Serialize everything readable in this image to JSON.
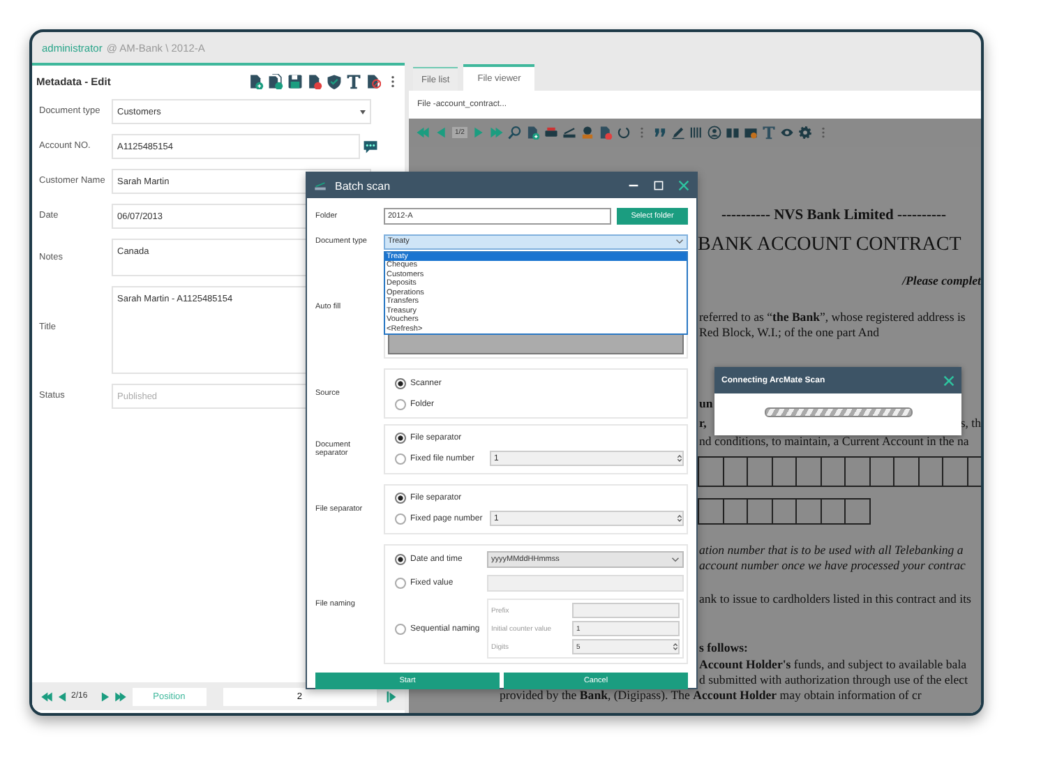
{
  "header": {
    "user": "administrator",
    "context": "@ AM-Bank \\ 2012-A"
  },
  "metadata": {
    "title": "Metadata - Edit",
    "fields": [
      {
        "label": "Document type",
        "kind": "select",
        "value": "Customers"
      },
      {
        "label": "Account NO.",
        "kind": "annotated",
        "value": "A1125485154"
      },
      {
        "label": "Customer Name",
        "kind": "text",
        "value": "Sarah Martin"
      },
      {
        "label": "Date",
        "kind": "text",
        "value": "06/07/2013"
      },
      {
        "label": "Notes",
        "kind": "memo",
        "value": "Canada"
      },
      {
        "label": "Title",
        "kind": "textarea",
        "value": "Sarah Martin - A1125485154"
      },
      {
        "label": "Status",
        "kind": "text",
        "placeholder": "Published"
      }
    ]
  },
  "footer": {
    "page": "2/16",
    "position_button": "Position",
    "position_value": "2"
  },
  "viewer": {
    "tabs": [
      {
        "label": "File list",
        "selected": false
      },
      {
        "label": "File viewer",
        "selected": true
      }
    ],
    "file_name": "File -account_contract...",
    "page": "1/2",
    "lines": [
      {
        "kind": "banner",
        "text": "---------- NVS Bank Limited ----------"
      },
      {
        "kind": "title",
        "text": "BANK ACCOUNT CONTRACT"
      },
      {
        "kind": "note",
        "text": "/Please complet"
      },
      {
        "kind": "body",
        "clipped": true,
        "text": "referred to as “**the Bank**”, whose registered address is"
      },
      {
        "kind": "body",
        "clipped": true,
        "text": "Red Block, W.I.; of the one part And"
      },
      {
        "kind": "section",
        "clipped": true,
        "text": "un"
      },
      {
        "kind": "split",
        "clipped": true,
        "text": "**r,**",
        "right": "s, th"
      },
      {
        "kind": "body",
        "clipped": true,
        "text": "nd conditions, to maintain, a Current Account in the na"
      },
      {
        "kind": "boxrow"
      },
      {
        "kind": "boxrowshort"
      },
      {
        "kind": "italic",
        "clipped": true,
        "text": "ation number that is to be used with all Telebanking a"
      },
      {
        "kind": "italic",
        "clipped": true,
        "text": "account number once we have processed your contrac"
      },
      {
        "kind": "body",
        "clipped": true,
        "text": "ank to issue to cardholders listed in this contract and its"
      },
      {
        "kind": "heading",
        "clipped": true,
        "text": "s follows:"
      },
      {
        "kind": "body",
        "clipped": true,
        "text": "**Account Holder's** funds, and subject to available bala"
      },
      {
        "kind": "body",
        "clipped": true,
        "text": "d submitted with authorization through use of the elect"
      },
      {
        "kind": "body",
        "clipped": false,
        "text": "provided by the **Bank**, (Digipass). The **Account Holder** may obtain information of cr"
      }
    ]
  },
  "batch_scan": {
    "title": "Batch scan",
    "folder": {
      "label": "Folder",
      "value": "2012-A",
      "button": "Select folder"
    },
    "document_type": {
      "label": "Document type",
      "value": "Treaty",
      "expanded": true,
      "options": [
        {
          "label": "Treaty",
          "selected": true
        },
        {
          "label": "Cheques",
          "selected": false
        },
        {
          "label": "Customers",
          "selected": false
        },
        {
          "label": "Deposits",
          "selected": false
        },
        {
          "label": "Operations",
          "selected": false
        },
        {
          "label": "Transfers",
          "selected": false
        },
        {
          "label": "Treasury",
          "selected": false
        },
        {
          "label": "Vouchers",
          "selected": false
        },
        {
          "label": "<Refresh>",
          "selected": false
        }
      ]
    },
    "auto_fill": {
      "label": "Auto fill"
    },
    "source": {
      "label": "Source",
      "options": [
        {
          "label": "Scanner",
          "selected": true
        },
        {
          "label": "Folder",
          "selected": false
        }
      ]
    },
    "document_separator": {
      "label": "Document separator",
      "options": [
        {
          "label": "File separator",
          "selected": true
        },
        {
          "label": "Fixed file number",
          "selected": false,
          "value": "1"
        }
      ]
    },
    "file_separator": {
      "label": "File separator",
      "options": [
        {
          "label": "File separator",
          "selected": true
        },
        {
          "label": "Fixed page number",
          "selected": false,
          "value": "1"
        }
      ]
    },
    "file_naming": {
      "label": "File naming",
      "options": [
        {
          "kind": "select",
          "label": "Date and time",
          "selected": true,
          "value": "yyyyMMddHHmmss"
        },
        {
          "kind": "field",
          "label": "Fixed value",
          "selected": false
        },
        {
          "kind": "sequential",
          "label": "Sequential naming",
          "selected": false,
          "prefix_label": "Prefix",
          "counter_label": "Initial counter value",
          "counter_value": "1",
          "digits_label": "Digits",
          "digits_value": "5"
        }
      ]
    },
    "buttons": [
      "Start",
      "Cancel"
    ]
  },
  "connecting_dialog": {
    "title": "Connecting ArcMate Scan"
  }
}
